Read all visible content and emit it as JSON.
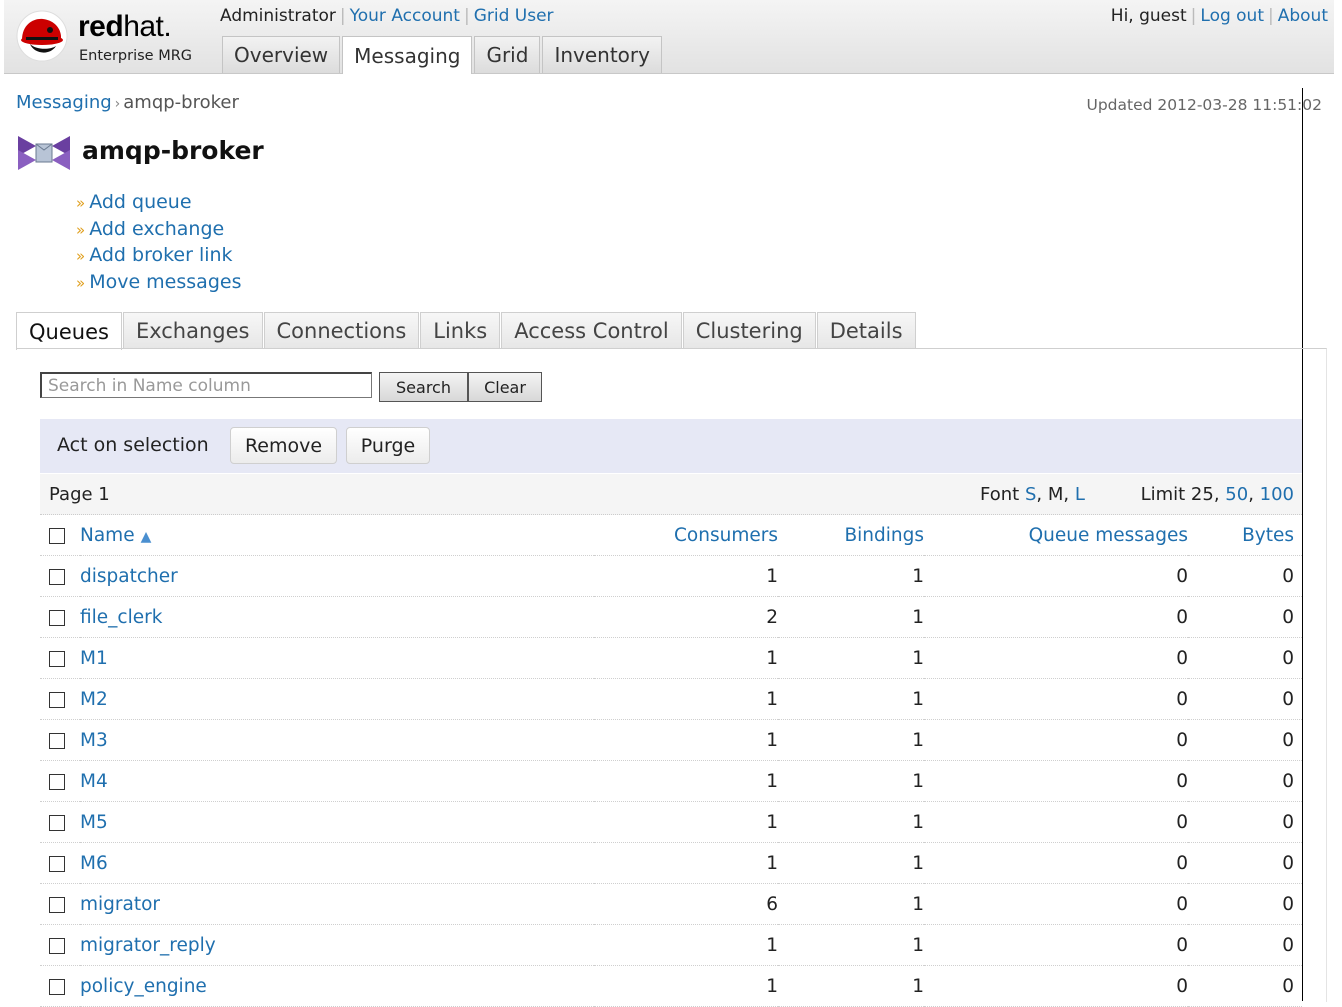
{
  "brand": {
    "name_bold": "red",
    "name_light": "hat.",
    "subtitle": "Enterprise MRG",
    "colors": {
      "hat_red": "#cc0000",
      "link_blue": "#1f6fae"
    }
  },
  "user_links": {
    "role": "Administrator",
    "your_account": "Your Account",
    "grid_user": "Grid User"
  },
  "right_links": {
    "greeting": "Hi, guest",
    "logout": "Log out",
    "about": "About"
  },
  "main_nav": {
    "tabs": [
      {
        "label": "Overview"
      },
      {
        "label": "Messaging"
      },
      {
        "label": "Grid"
      },
      {
        "label": "Inventory"
      }
    ],
    "active": "Messaging"
  },
  "breadcrumb": {
    "parent": "Messaging",
    "separator": "›",
    "current": "amqp-broker"
  },
  "updated": "Updated 2012-03-28 11:51:02",
  "page_title": "amqp-broker",
  "actions": [
    {
      "label": "Add queue"
    },
    {
      "label": "Add exchange"
    },
    {
      "label": "Add broker link"
    },
    {
      "label": "Move messages"
    }
  ],
  "section_tabs": {
    "tabs": [
      {
        "label": "Queues"
      },
      {
        "label": "Exchanges"
      },
      {
        "label": "Connections"
      },
      {
        "label": "Links"
      },
      {
        "label": "Access Control"
      },
      {
        "label": "Clustering"
      },
      {
        "label": "Details"
      }
    ],
    "active": "Queues"
  },
  "search": {
    "placeholder": "Search in Name column",
    "search_label": "Search",
    "clear_label": "Clear"
  },
  "selection": {
    "label": "Act on selection",
    "remove_label": "Remove",
    "purge_label": "Purge"
  },
  "paging": {
    "page": "Page 1",
    "font_label": "Font",
    "font_s": "S",
    "font_m": "M",
    "font_l": "L",
    "limit_label": "Limit",
    "limit_25": "25",
    "limit_50": "50",
    "limit_100": "100"
  },
  "table": {
    "columns": {
      "name": "Name",
      "consumers": "Consumers",
      "bindings": "Bindings",
      "queue_messages": "Queue messages",
      "bytes": "Bytes"
    },
    "sort_icon": "sort-ascending-icon",
    "rows": [
      {
        "name": "dispatcher",
        "consumers": "1",
        "bindings": "1",
        "queue_messages": "0",
        "bytes": "0"
      },
      {
        "name": "file_clerk",
        "consumers": "2",
        "bindings": "1",
        "queue_messages": "0",
        "bytes": "0"
      },
      {
        "name": "M1",
        "consumers": "1",
        "bindings": "1",
        "queue_messages": "0",
        "bytes": "0"
      },
      {
        "name": "M2",
        "consumers": "1",
        "bindings": "1",
        "queue_messages": "0",
        "bytes": "0"
      },
      {
        "name": "M3",
        "consumers": "1",
        "bindings": "1",
        "queue_messages": "0",
        "bytes": "0"
      },
      {
        "name": "M4",
        "consumers": "1",
        "bindings": "1",
        "queue_messages": "0",
        "bytes": "0"
      },
      {
        "name": "M5",
        "consumers": "1",
        "bindings": "1",
        "queue_messages": "0",
        "bytes": "0"
      },
      {
        "name": "M6",
        "consumers": "1",
        "bindings": "1",
        "queue_messages": "0",
        "bytes": "0"
      },
      {
        "name": "migrator",
        "consumers": "6",
        "bindings": "1",
        "queue_messages": "0",
        "bytes": "0"
      },
      {
        "name": "migrator_reply",
        "consumers": "1",
        "bindings": "1",
        "queue_messages": "0",
        "bytes": "0"
      },
      {
        "name": "policy_engine",
        "consumers": "1",
        "bindings": "1",
        "queue_messages": "0",
        "bytes": "0"
      }
    ]
  }
}
